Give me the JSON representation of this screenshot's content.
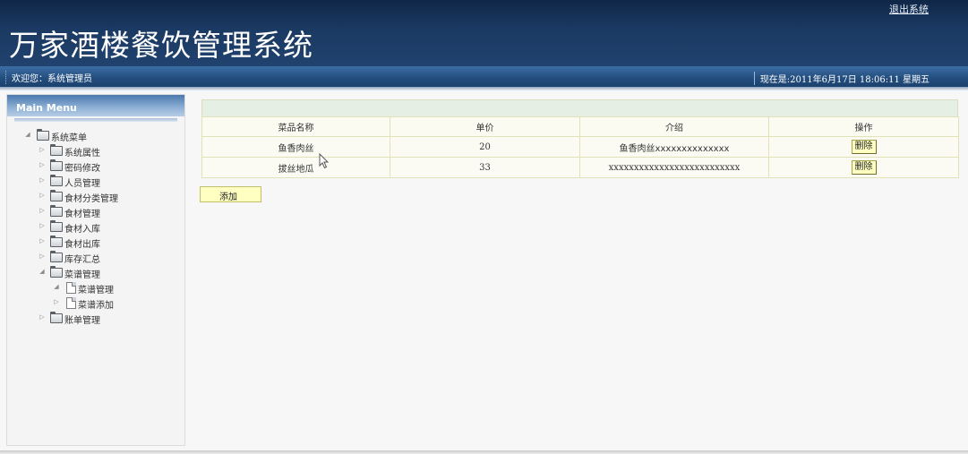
{
  "header": {
    "title": "万家酒楼餐饮管理系统",
    "logout_label": "退出系统"
  },
  "infobar": {
    "welcome": "欢迎您：系统管理员",
    "clock": "现在是:2011年6月17日 18:06:11 星期五"
  },
  "sidebar": {
    "menu_title": "Main Menu",
    "root": {
      "label": "系统菜单",
      "icon": "folder-open-icon"
    },
    "items": [
      {
        "label": "系统属性",
        "icon": "folder-icon"
      },
      {
        "label": "密码修改",
        "icon": "folder-icon"
      },
      {
        "label": "人员管理",
        "icon": "folder-icon"
      },
      {
        "label": "食材分类管理",
        "icon": "folder-icon"
      },
      {
        "label": "食材管理",
        "icon": "folder-icon"
      },
      {
        "label": "食材入库",
        "icon": "folder-icon"
      },
      {
        "label": "食材出库",
        "icon": "folder-icon"
      },
      {
        "label": "库存汇总",
        "icon": "folder-icon"
      },
      {
        "label": "菜谱管理",
        "icon": "folder-open-icon",
        "expanded": true,
        "children": [
          {
            "label": "菜谱管理",
            "icon": "document-icon"
          },
          {
            "label": "菜谱添加",
            "icon": "document-icon"
          }
        ]
      },
      {
        "label": "账单管理",
        "icon": "folder-icon"
      }
    ]
  },
  "dish_table": {
    "columns": [
      "菜品名称",
      "单价",
      "介绍",
      "操作"
    ],
    "rows": [
      {
        "name": "鱼香肉丝",
        "price": "20",
        "intro": "鱼香肉丝xxxxxxxxxxxxxx",
        "action": "删除"
      },
      {
        "name": "拔丝地瓜",
        "price": "33",
        "intro": "xxxxxxxxxxxxxxxxxxxxxxxxxx",
        "action": "删除"
      }
    ]
  },
  "add_button_label": "添加",
  "colors": {
    "header_dark": "#0f2747",
    "infobar_blue": "#244f80",
    "button_yellow": "#ffffc2",
    "table_border": "#e2e2b8"
  }
}
